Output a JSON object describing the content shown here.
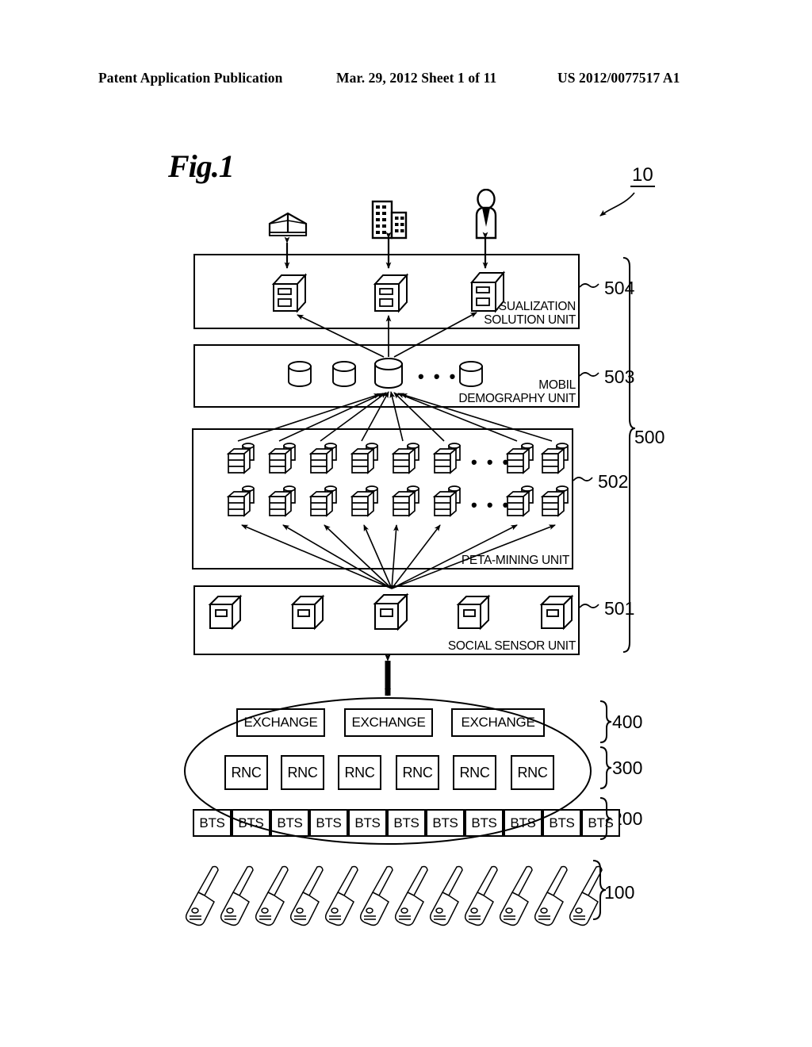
{
  "header": {
    "publication": "Patent Application Publication",
    "date_sheet": "Mar. 29, 2012  Sheet 1 of 11",
    "patent_number": "US 2012/0077517 A1"
  },
  "figure": {
    "label": "Fig.1",
    "system_ref": "10"
  },
  "consumers": [
    {
      "name": "warehouse-icon",
      "label": ""
    },
    {
      "name": "office-buildings-icon",
      "label": ""
    },
    {
      "name": "person-icon",
      "label": ""
    }
  ],
  "units": [
    {
      "ref": "504",
      "caption": "VISUALIZATION\nSOLUTION UNIT",
      "icon_type": "server",
      "icon_count": 3
    },
    {
      "ref": "503",
      "caption": "MOBIL\nDEMOGRAPHY UNIT",
      "icon_type": "cylinder",
      "icon_count": 4,
      "ellipsis": "• • •"
    },
    {
      "ref": "502",
      "caption": "PETA-MINING UNIT",
      "icon_type": "rack-cluster",
      "rows": 2,
      "icons_per_row": 8,
      "ellipsis": "• • •"
    },
    {
      "ref": "501",
      "caption": "SOCIAL SENSOR UNIT",
      "icon_type": "sensor-server",
      "icon_count": 5
    }
  ],
  "group_ref": "500",
  "network": {
    "exchange_label": "EXCHANGE",
    "exchange_count": 3,
    "exchange_ref": "400",
    "rnc_label": "RNC",
    "rnc_count": 6,
    "rnc_ref": "300",
    "bts_label": "BTS",
    "bts_count": 11,
    "bts_ref": "200"
  },
  "terminals": {
    "ref": "100",
    "count": 12,
    "name": "mobile-phone-icon"
  }
}
